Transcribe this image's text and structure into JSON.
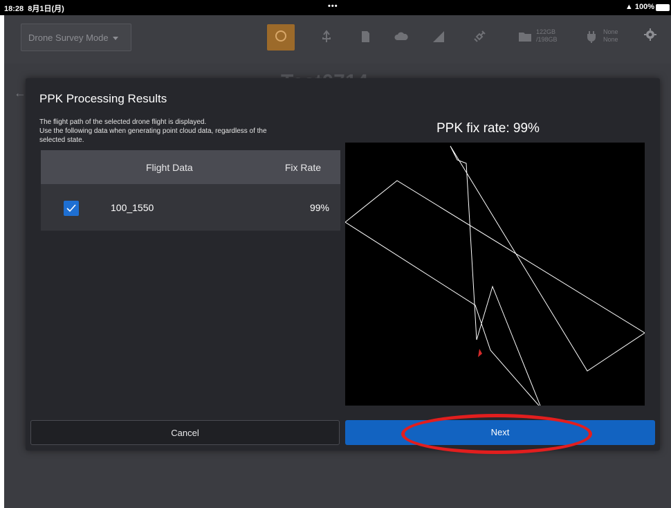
{
  "status_bar": {
    "time": "18:28",
    "date": "8月1日(月)",
    "dots": "•••",
    "battery": "100%"
  },
  "toolbar": {
    "mode_label": "Drone Survey Mode",
    "storage_used": "122GB",
    "storage_total": "/198GB",
    "power_line1": "None",
    "power_line2": "None"
  },
  "background": {
    "project_title": "Test0714"
  },
  "dialog": {
    "title": "PPK Processing Results",
    "description_lines": [
      "The flight path of the selected drone flight is displayed.",
      "Use the following data when generating point cloud data, regardless of the",
      "selected state."
    ],
    "table": {
      "columns": [
        "Flight Data",
        "Fix Rate"
      ],
      "rows": [
        {
          "checked": true,
          "flight_data": "100_1550",
          "fix_rate": "99%"
        }
      ]
    },
    "fix_rate_title": "PPK fix rate: 99%",
    "cancel_label": "Cancel",
    "next_label": "Next"
  },
  "colors": {
    "accent": "#1263c1",
    "highlight": "#e21e1e",
    "dialog_bg": "#26272c"
  }
}
